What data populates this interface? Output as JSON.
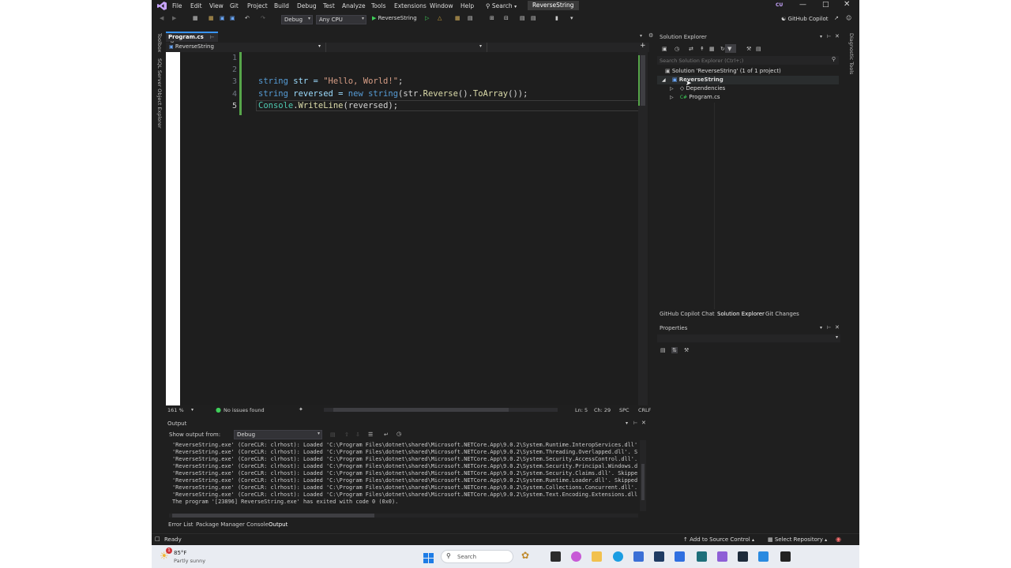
{
  "menu": [
    "File",
    "Edit",
    "View",
    "Git",
    "Project",
    "Build",
    "Debug",
    "Test",
    "Analyze",
    "Tools",
    "Extensions",
    "Window",
    "Help"
  ],
  "search_label": "Search",
  "window_title": "ReverseString",
  "user_initials": "CU",
  "copilot_label": "GitHub Copilot",
  "toolbar": {
    "config": "Debug",
    "platform": "Any CPU",
    "run_target": "ReverseString"
  },
  "left_tabs": [
    "Toolbox",
    "SQL Server Object Explorer"
  ],
  "right_tabs": [
    "Diagnostic Tools"
  ],
  "doc_tab": "Program.cs",
  "nav_scope": "ReverseString",
  "code": {
    "line_numbers": [
      "1",
      "2",
      "3",
      "4",
      "5"
    ],
    "line3": {
      "t1": "string",
      "t2": " str = ",
      "t3": "\"Hello, World!\"",
      "t4": ";"
    },
    "line4": {
      "t1": "string",
      "t2": " reversed = ",
      "t3": "new",
      "t4": " ",
      "t5": "string",
      "t6": "(str.",
      "t7": "Reverse",
      "t8": "().",
      "t9": "ToArray",
      "t10": "());"
    },
    "line5": {
      "t1": "Console",
      "t2": ".",
      "t3": "WriteLine",
      "t4": "(reversed);"
    }
  },
  "editor_status": {
    "zoom": "161 %",
    "issues": "No issues found",
    "ln": "Ln: 5",
    "ch": "Ch: 29",
    "spc": "SPC",
    "crlf": "CRLF"
  },
  "solution_explorer": {
    "title": "Solution Explorer",
    "search_placeholder": "Search Solution Explorer (Ctrl+;)",
    "solution": "Solution 'ReverseString' (1 of 1 project)",
    "project": "ReverseString",
    "dependencies": "Dependencies",
    "file": "Program.cs"
  },
  "right_tabs_bottom": [
    "GitHub Copilot Chat",
    "Solution Explorer",
    "Git Changes"
  ],
  "properties_title": "Properties",
  "output": {
    "title": "Output",
    "show_from_label": "Show output from:",
    "source": "Debug",
    "lines": [
      "'ReverseString.exe' (CoreCLR: clrhost): Loaded 'C:\\Program Files\\dotnet\\shared\\Microsoft.NETCore.App\\9.0.2\\System.Runtime.InteropServices.dll'",
      "'ReverseString.exe' (CoreCLR: clrhost): Loaded 'C:\\Program Files\\dotnet\\shared\\Microsoft.NETCore.App\\9.0.2\\System.Threading.Overlapped.dll'. S",
      "'ReverseString.exe' (CoreCLR: clrhost): Loaded 'C:\\Program Files\\dotnet\\shared\\Microsoft.NETCore.App\\9.0.2\\System.Security.AccessControl.dll'.",
      "'ReverseString.exe' (CoreCLR: clrhost): Loaded 'C:\\Program Files\\dotnet\\shared\\Microsoft.NETCore.App\\9.0.2\\System.Security.Principal.Windows.d",
      "'ReverseString.exe' (CoreCLR: clrhost): Loaded 'C:\\Program Files\\dotnet\\shared\\Microsoft.NETCore.App\\9.0.2\\System.Security.Claims.dll'. Skippe",
      "'ReverseString.exe' (CoreCLR: clrhost): Loaded 'C:\\Program Files\\dotnet\\shared\\Microsoft.NETCore.App\\9.0.2\\System.Runtime.Loader.dll'. Skipped",
      "'ReverseString.exe' (CoreCLR: clrhost): Loaded 'C:\\Program Files\\dotnet\\shared\\Microsoft.NETCore.App\\9.0.2\\System.Collections.Concurrent.dll'.",
      "'ReverseString.exe' (CoreCLR: clrhost): Loaded 'C:\\Program Files\\dotnet\\shared\\Microsoft.NETCore.App\\9.0.2\\System.Text.Encoding.Extensions.dll",
      "The program '[23896] ReverseString.exe' has exited with code 0 (0x0)."
    ]
  },
  "bottom_tabs": [
    "Error List",
    "Package Manager Console",
    "Output"
  ],
  "status": {
    "ready": "Ready",
    "source_control": "Add to Source Control",
    "repo": "Select Repository"
  },
  "taskbar": {
    "temp": "85°F",
    "weather": "Partly sunny",
    "search": "Search",
    "badge": "1"
  },
  "colors": {
    "accent": "#3794ff",
    "background": "#1f1f1f",
    "editor": "#1e1e1e"
  }
}
